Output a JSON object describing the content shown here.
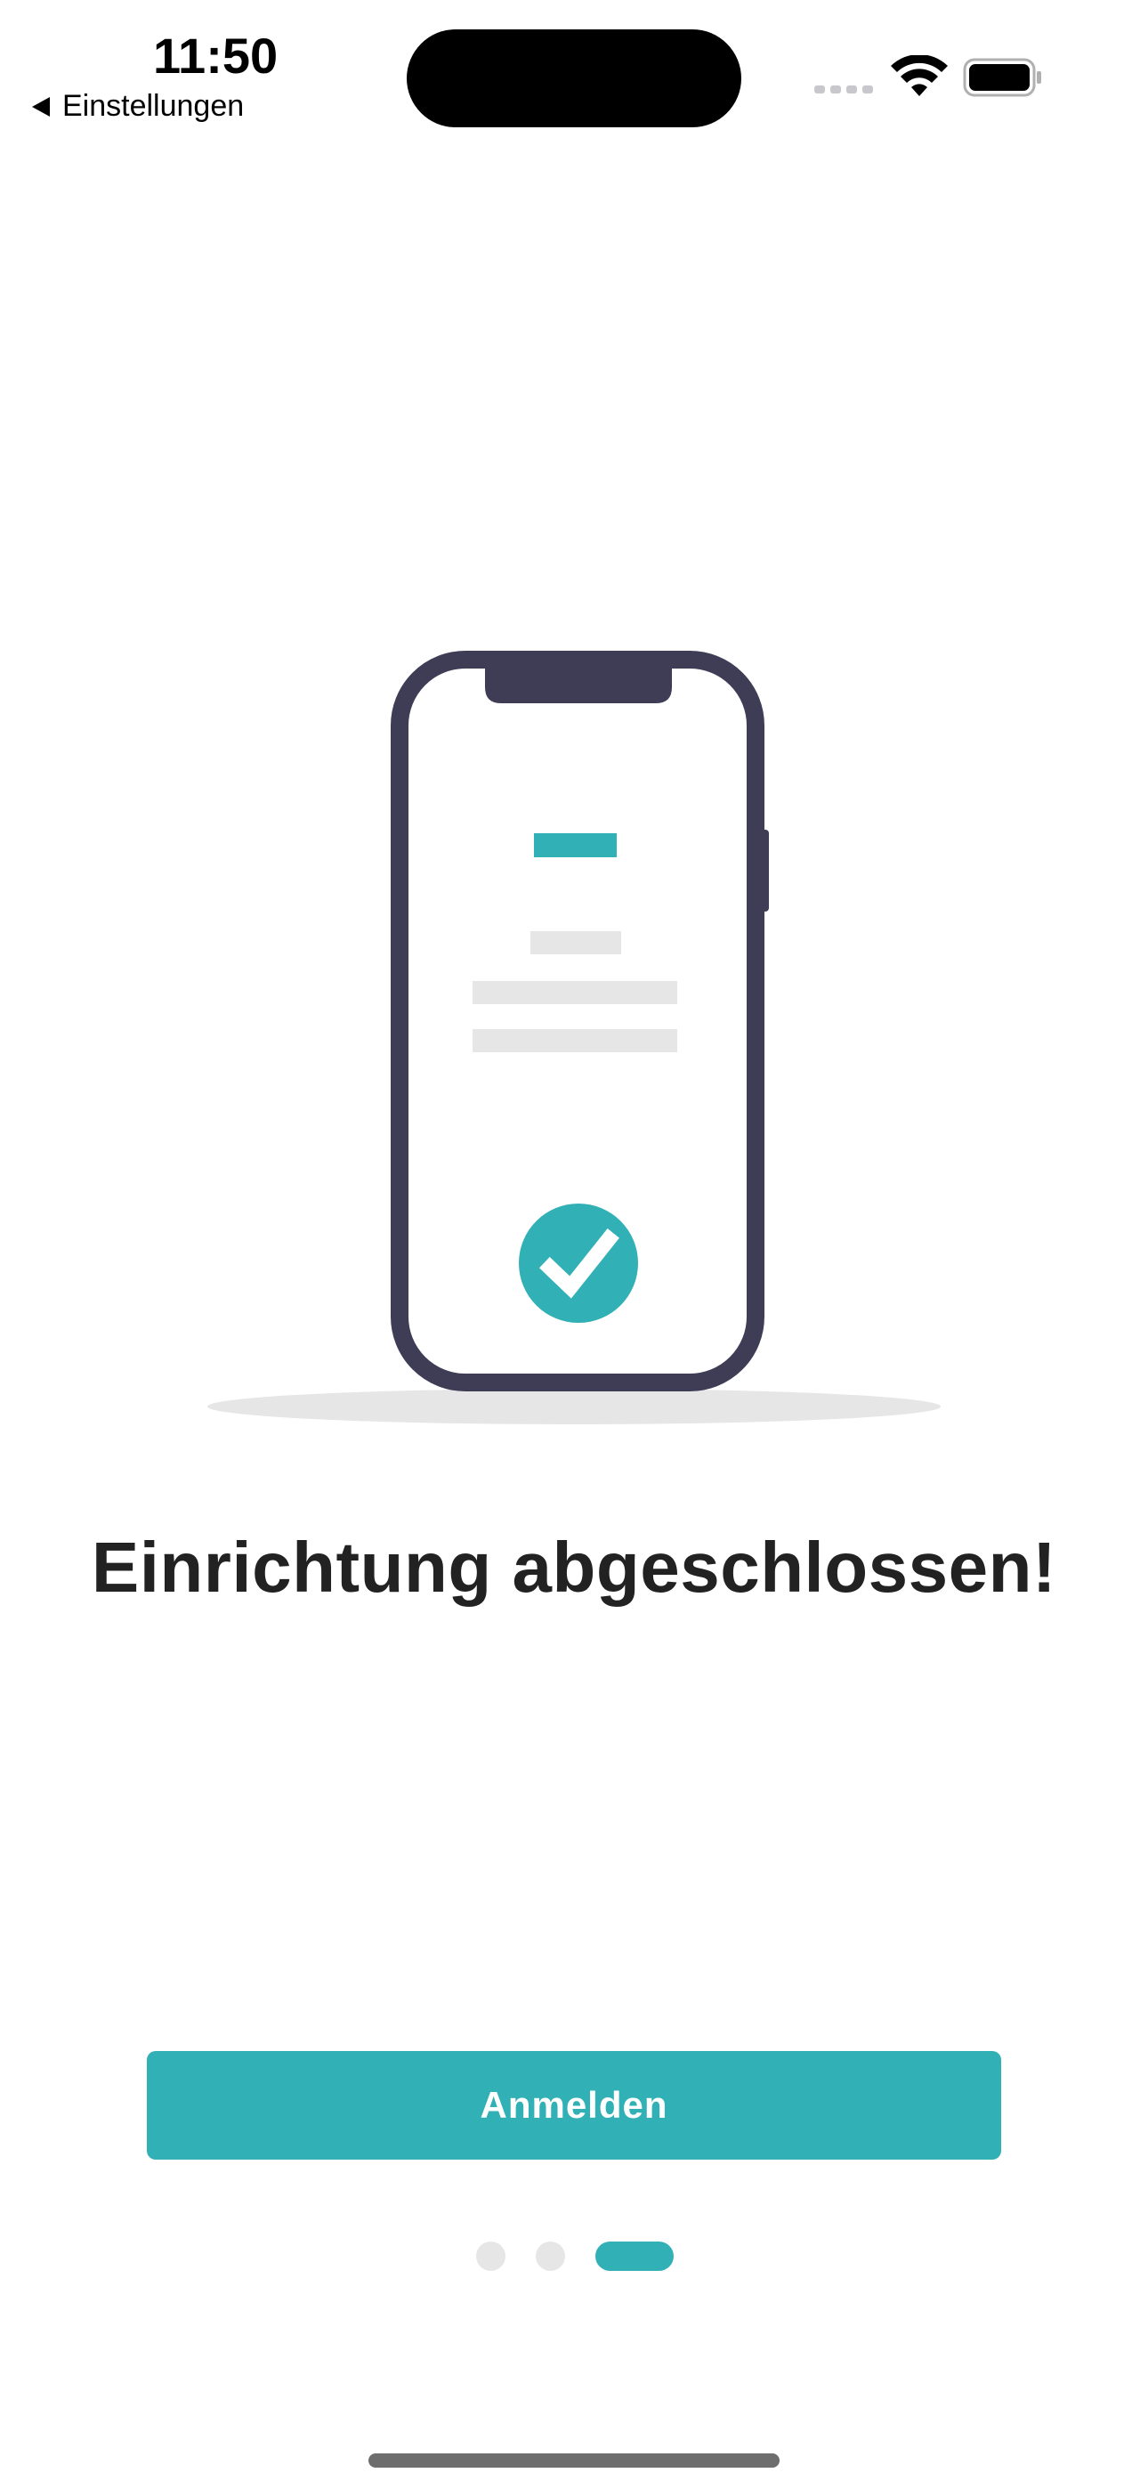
{
  "status_bar": {
    "time": "11:50",
    "back_label": "Einstellungen"
  },
  "icons": {
    "back": "back-arrow-icon",
    "wifi": "wifi-icon",
    "battery": "battery-icon",
    "signal": "cellular-signal-icon",
    "success": "checkmark-icon"
  },
  "illustration": {
    "name": "phone-setup-complete-illustration"
  },
  "main": {
    "title": "Einrichtung abgeschlossen!",
    "button_label": "Anmelden"
  },
  "pagination": {
    "total_pages": 3,
    "current_page": 3
  },
  "colors": {
    "accent": "#31b0b6",
    "phone_frame": "#3f3d56",
    "placeholder_line": "#e6e6e6",
    "title_text": "#222222"
  }
}
